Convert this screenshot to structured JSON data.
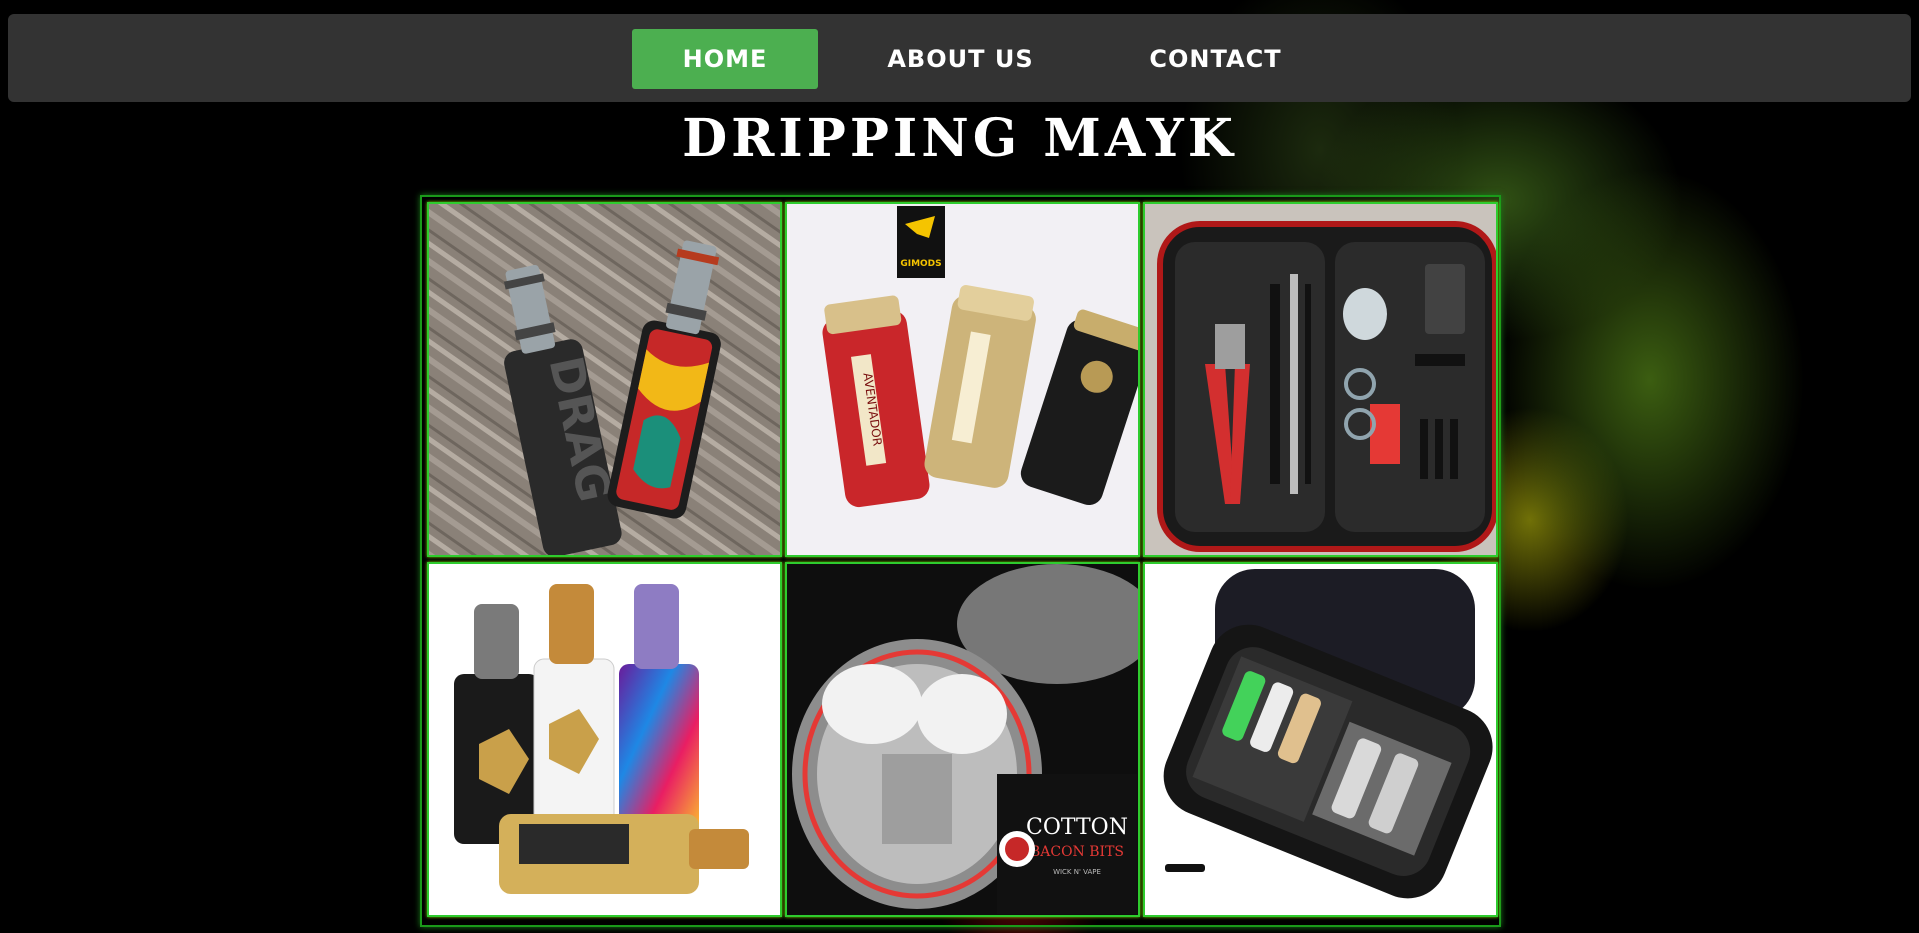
{
  "nav": {
    "home": "HOME",
    "about": "ABOUT US",
    "contact": "CONTACT",
    "active_color": "#4CAF50",
    "bar_color": "#333333"
  },
  "page": {
    "title": "DRIPPING MAYK"
  },
  "gallery": {
    "items": [
      {
        "name": "drag-mod-photo",
        "text": "DRAG"
      },
      {
        "name": "aventador-mods-photo",
        "text": "AVENTADOR",
        "logo": "GIMODS"
      },
      {
        "name": "tool-kit-photo"
      },
      {
        "name": "colorful-mods-photo"
      },
      {
        "name": "coil-build-photo",
        "text": "COTTON",
        "text2": "BACON BITS",
        "text3": "WICK N' VAPE"
      },
      {
        "name": "carry-case-photo"
      }
    ],
    "border_color": "#2ecc2e"
  }
}
